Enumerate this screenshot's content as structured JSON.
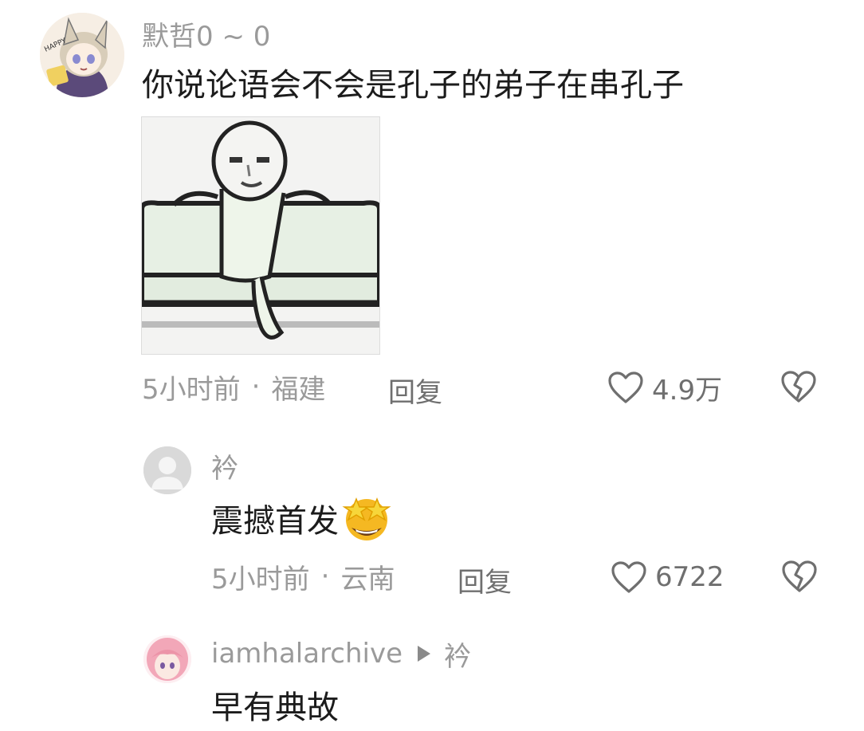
{
  "comments": [
    {
      "username": "默哲0 ~ 0",
      "text": "你说论语会不会是孔子的弟子在串孔子",
      "time": "5小时前",
      "location": "福建",
      "reply_label": "回复",
      "likes": "4.9万",
      "avatar_caption": "HAPPY"
    },
    {
      "username": "衿",
      "text": "震撼首发",
      "time": "5小时前",
      "location": "云南",
      "reply_label": "回复",
      "likes": "6722"
    },
    {
      "username": "iamhalarchive",
      "reply_to": "衿",
      "text": "早有典故"
    }
  ],
  "separator": "·",
  "icons": [
    "heart-icon",
    "broken-heart-icon",
    "play-arrow-icon",
    "star-eyes-emoji"
  ],
  "colors": {
    "meta": "#9a9a9a",
    "text": "#1c1c1c",
    "emoji": "#f5b822"
  }
}
